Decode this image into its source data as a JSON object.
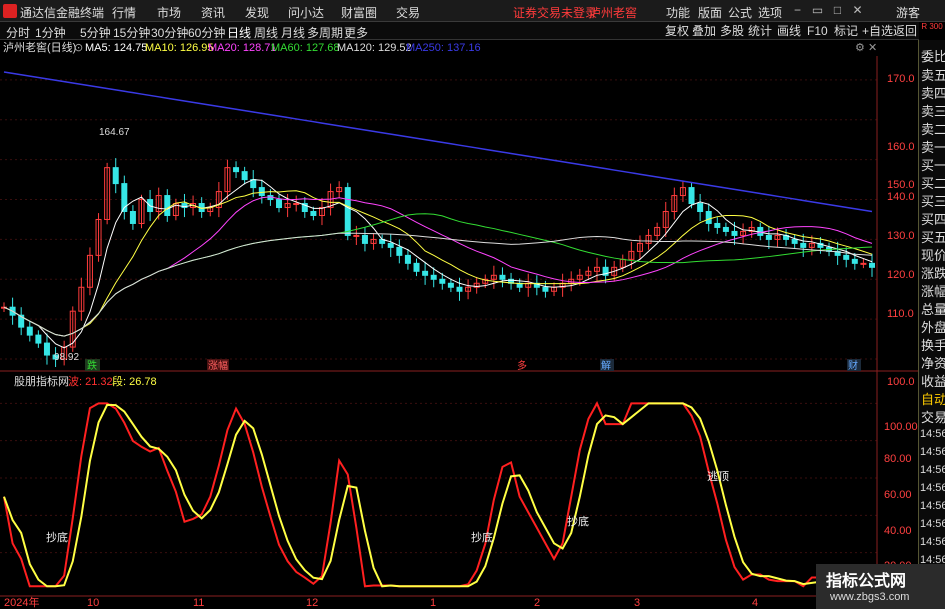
{
  "menubar": {
    "app": "通达信金融终端",
    "items": [
      "行情",
      "市场",
      "资讯",
      "发现",
      "问小达",
      "财富圈",
      "交易"
    ],
    "warning": "证券交易未登录",
    "stock": "泸州老窖",
    "right_items": [
      "功能",
      "版面",
      "公式",
      "选项"
    ],
    "guest": "游客"
  },
  "period": {
    "tabs": [
      "分时",
      "1分钟",
      "5分钟",
      "15分钟",
      "30分钟",
      "60分钟",
      "日线",
      "周线",
      "月线",
      "多周期",
      "更多"
    ],
    "active": "日线",
    "buttons": [
      "复权",
      "叠加",
      "多股",
      "统计",
      "画线",
      "F10",
      "标记",
      "+自选",
      "返回"
    ]
  },
  "indicators": {
    "title": "泸州老窖(日线)",
    "ma5": "MA5: 124.75",
    "ma10": "MA10: 126.95",
    "ma20": "MA20: 128.71",
    "ma60": "MA60: 127.68",
    "ma120": "MA120: 129.52",
    "ma250": "MA250: 137.16"
  },
  "colors": {
    "up": "#ff3c3c",
    "down": "#36e6e6",
    "ma5": "#ffffff",
    "ma10": "#ffff44",
    "ma20": "#ff44ff",
    "ma60": "#33dd33",
    "ma120": "#dddddd",
    "ma250": "#3a3ae6",
    "wave": "#ff2020",
    "seg": "#ffff44"
  },
  "price_axis": [
    "170.0",
    "160.0",
    "150.0",
    "140.0",
    "130.0",
    "120.0",
    "110.0",
    "100.0"
  ],
  "annotations": {
    "high": "164.67",
    "low": "98.92"
  },
  "events": [
    "跌",
    "涨幅",
    "多",
    "解",
    "财"
  ],
  "sub": {
    "title": "股朋指标网",
    "wave": "波: 21.32",
    "seg": "段: 26.78",
    "labels": [
      "抄底",
      "抄底",
      "抄底",
      "逃顶"
    ],
    "axis": [
      "100.00",
      "80.00",
      "60.00",
      "40.00",
      "20.00"
    ]
  },
  "time_axis": [
    "2024年",
    "10",
    "11",
    "12",
    "1",
    "2",
    "3",
    "4"
  ],
  "right_panel": {
    "items": [
      "委比",
      "卖五",
      "卖四",
      "卖三",
      "卖二",
      "卖一",
      "买一",
      "买二",
      "买三",
      "买四",
      "买五",
      "现价",
      "涨跌",
      "涨幅",
      "总量",
      "外盘",
      "换手",
      "净资",
      "收益"
    ],
    "tabs": [
      "自动",
      "交易"
    ],
    "times": [
      "14:56",
      "14:56",
      "14:56",
      "14:56",
      "14:56",
      "14:56",
      "14:56",
      "14:56"
    ],
    "badge": "R 300"
  },
  "watermark": {
    "title": "指标公式网",
    "url": "www.zbgs3.com"
  },
  "chart_data": {
    "type": "candlestick",
    "ylim": [
      97,
      176
    ],
    "close": [
      113,
      111,
      108,
      106,
      104,
      101,
      100,
      103,
      112,
      118,
      126,
      135,
      148,
      144,
      137,
      134,
      140,
      137,
      141,
      136,
      139,
      138,
      139,
      137,
      138,
      142,
      148,
      147,
      145,
      143,
      141,
      140,
      138,
      139,
      139,
      137,
      136,
      138,
      142,
      143,
      131,
      131,
      129,
      130,
      129,
      128,
      126,
      124,
      122,
      121,
      120,
      119,
      118,
      117,
      118,
      119,
      120,
      121,
      120,
      119,
      118,
      119,
      118,
      117,
      118,
      119,
      120,
      121,
      122,
      123,
      121,
      123,
      125,
      127,
      129,
      131,
      133,
      137,
      141,
      143,
      139,
      137,
      134,
      133,
      132,
      131,
      132,
      133,
      131,
      130,
      131,
      130,
      129,
      128,
      129,
      128,
      127,
      126,
      125,
      124,
      124,
      123
    ]
  }
}
